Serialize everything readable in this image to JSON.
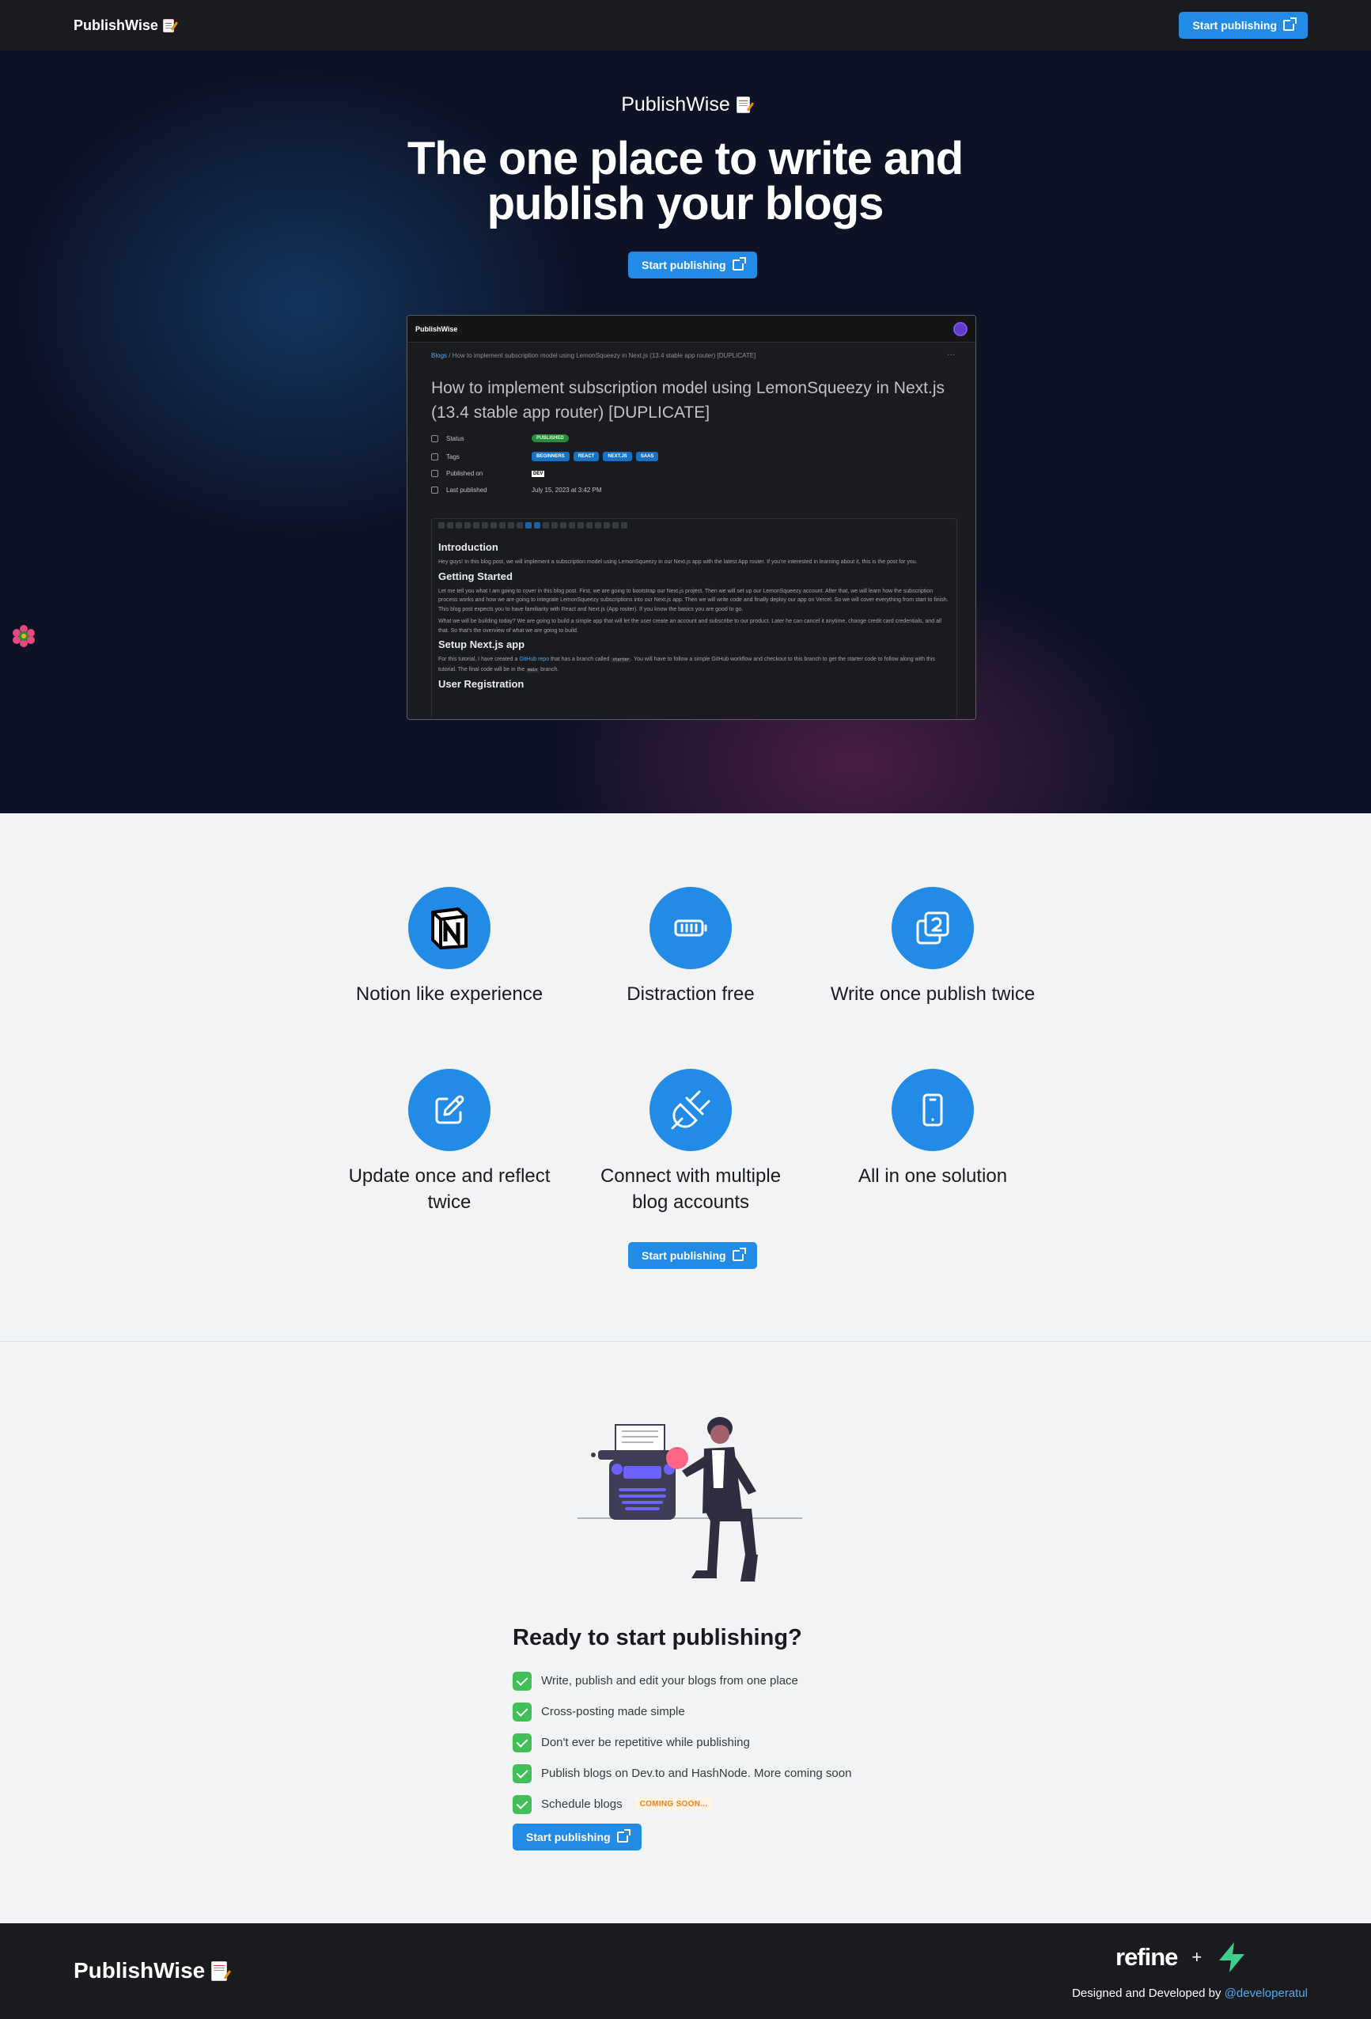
{
  "nav": {
    "brand": "PublishWise",
    "cta_label": "Start publishing"
  },
  "hero": {
    "brand": "PublishWise",
    "title": "The one place to write and publish your blogs",
    "cta_label": "Start publishing"
  },
  "preview": {
    "brand": "PublishWise",
    "breadcrumb_root": "Blogs",
    "breadcrumb_sep": "/",
    "breadcrumb_current": "How to implement subscription model using LemonSqueezy in Next.js (13.4 stable app router) [DUPLICATE]",
    "menu_dots": "···",
    "title": "How to implement subscription model using LemonSqueezy in Next.js (13.4 stable app router) [DUPLICATE]",
    "props": {
      "status_label": "Status",
      "status_value": "PUBLISHED",
      "tags_label": "Tags",
      "tags": [
        "BEGINNERS",
        "REACT",
        "NEXT.JS",
        "SAAS"
      ],
      "published_label": "Published on",
      "published_value": "DEV",
      "last_label": "Last published",
      "last_value": "July 15, 2023 at 3:42 PM"
    },
    "content": {
      "h_intro": "Introduction",
      "p_intro": "Hey guys! In this blog post, we will implement a subscription model using LemonSqueezy in our Next.js app with the latest App router. If you're interested in learning about it, this is the post for you.",
      "h_start": "Getting Started",
      "p_start1": "Let me tell you what I am going to cover in this blog post. First, we are going to bootstrap our Next.js project. Then we will set up our LemonSqueezy account. After that, we will learn how the subscription process works and how we are going to integrate LemonSqueezy subscriptions into our Next.js app. Then we will write code and finally deploy our app on Vercel. So we will cover everything from start to finish. This blog post expects you to have familiarity with React and Next.js (App router). If you know the basics you are good to go.",
      "p_start2": "What we will be building today? We are going to build a simple app that will let the user create an account and subscribe to our product. Later he can cancel it anytime, change credit card credentials, and all that. So that's the overview of what we are going to build.",
      "h_setup": "Setup Next.js app",
      "p_setup_a": "For this tutorial, I have created a",
      "p_setup_link": "GitHub repo",
      "p_setup_b": "that has a branch called",
      "p_setup_code1": "starter",
      "p_setup_c": ". You will have to follow a simple GitHub workflow and checkout to this branch to get the starter code to follow along with this tutorial. The final code will be in the",
      "p_setup_code2": "main",
      "p_setup_d": "branch.",
      "h_user": "User Registration"
    }
  },
  "features": {
    "items": [
      {
        "label": "Notion like experience",
        "icon": "notion-icon"
      },
      {
        "label": "Distraction free",
        "icon": "battery-icon"
      },
      {
        "label": "Write once publish twice",
        "icon": "copy-two-icon"
      },
      {
        "label": "Update once and reflect twice",
        "icon": "edit-icon"
      },
      {
        "label": "Connect with multiple blog accounts",
        "icon": "plug-icon"
      },
      {
        "label": "All in one solution",
        "icon": "phone-icon"
      }
    ],
    "cta_label": "Start publishing"
  },
  "ready": {
    "title": "Ready to start publishing?",
    "items": [
      "Write, publish and edit your blogs from one place",
      "Cross-posting made simple",
      "Don't ever be repetitive while publishing",
      "Publish blogs on Dev.to and HashNode. More coming soon",
      "Schedule blogs"
    ],
    "coming_soon": "COMING SOON...",
    "cta_label": "Start publishing"
  },
  "footer": {
    "brand": "PublishWise",
    "partner_logo": "refine",
    "plus": "+",
    "credit_text": "Designed and Developed by",
    "credit_handle": "@developeratul"
  },
  "colors": {
    "accent": "#228be6",
    "dark": "#1a1b1e",
    "success": "#40c057",
    "warning": "#fd7e14"
  }
}
